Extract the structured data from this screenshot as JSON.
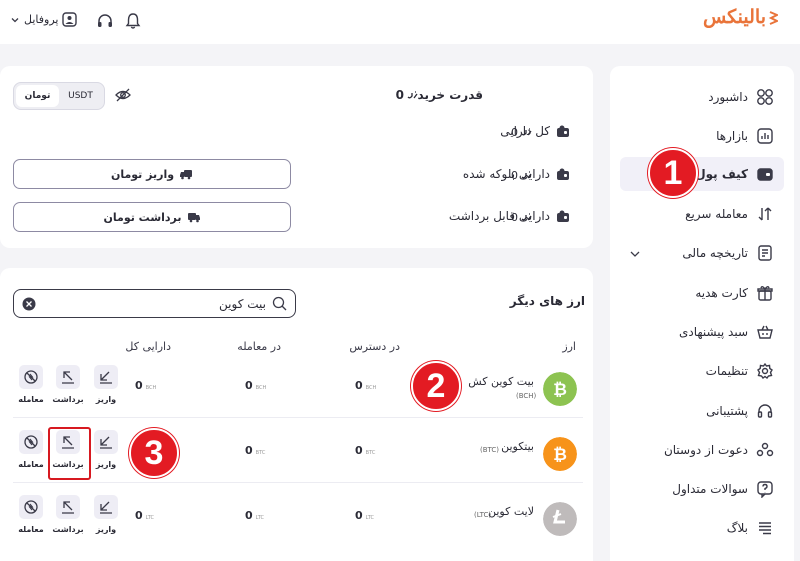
{
  "brand": {
    "name": "بالینکس",
    "color": "#e9743a"
  },
  "topbar": {
    "profile_label": "پروفایل"
  },
  "sidebar": {
    "items": [
      {
        "label": "داشبورد",
        "icon": "dashboard-icon"
      },
      {
        "label": "بازارها",
        "icon": "markets-icon"
      },
      {
        "label": "کیف پول",
        "icon": "wallet-icon",
        "active": true
      },
      {
        "label": "معامله سریع",
        "icon": "swap-icon"
      },
      {
        "label": "تاریخچه مالی",
        "icon": "history-icon"
      },
      {
        "label": "کارت هدیه",
        "icon": "gift-icon"
      },
      {
        "label": "سبد پیشنهادی",
        "icon": "basket-icon"
      },
      {
        "label": "تنظیمات",
        "icon": "gear-icon"
      },
      {
        "label": "پشتیبانی",
        "icon": "headset-icon"
      },
      {
        "label": "دعوت از دوستان",
        "icon": "invite-icon"
      },
      {
        "label": "سوالات متداول",
        "icon": "faq-icon"
      },
      {
        "label": "بلاگ",
        "icon": "blog-icon"
      }
    ]
  },
  "balance": {
    "buying_power_label": "قدرت خرید",
    "buying_power_value": "0",
    "currency_toggle": {
      "left": "USDT",
      "right": "تومان",
      "selected": "تومان"
    },
    "total_label": "کل دارایی",
    "total_value": "0",
    "blocked_label": "دارایی بلوکه شده",
    "blocked_value": "0",
    "withdrawable_label": "دارایی قابل برداشت",
    "withdrawable_value": "0",
    "deposit_button": "واریز تومان",
    "withdraw_button": "برداشت تومان"
  },
  "other_assets": {
    "title": "ارز های دیگر",
    "search_value": "بیت کوین",
    "columns": {
      "coin": "ارز",
      "available": "در دسترس",
      "in_trade": "در معامله",
      "total": "دارایی کل"
    },
    "rows": [
      {
        "name": "بیت کوین کش",
        "code": "(BCH)",
        "unit": "BCH",
        "available": "0",
        "in_trade": "0",
        "total": "0",
        "color": "#8dc351"
      },
      {
        "name": "بیتکوین",
        "code": "(BTC)",
        "unit": "BTC",
        "available": "0",
        "in_trade": "0",
        "total": "0",
        "color": "#f7931a"
      },
      {
        "name": "لایت کوین",
        "code": "(LTC)",
        "unit": "LTC",
        "available": "0",
        "in_trade": "0",
        "total": "0",
        "color": "#bfbbbb"
      }
    ],
    "actions": {
      "deposit": "واریز",
      "withdraw": "برداشت",
      "trade": "معامله"
    }
  },
  "markers": [
    "1",
    "2",
    "3"
  ],
  "colors": {
    "accent": "#e9743a",
    "marker": "#e31b23",
    "icon": "#3a3a48"
  }
}
